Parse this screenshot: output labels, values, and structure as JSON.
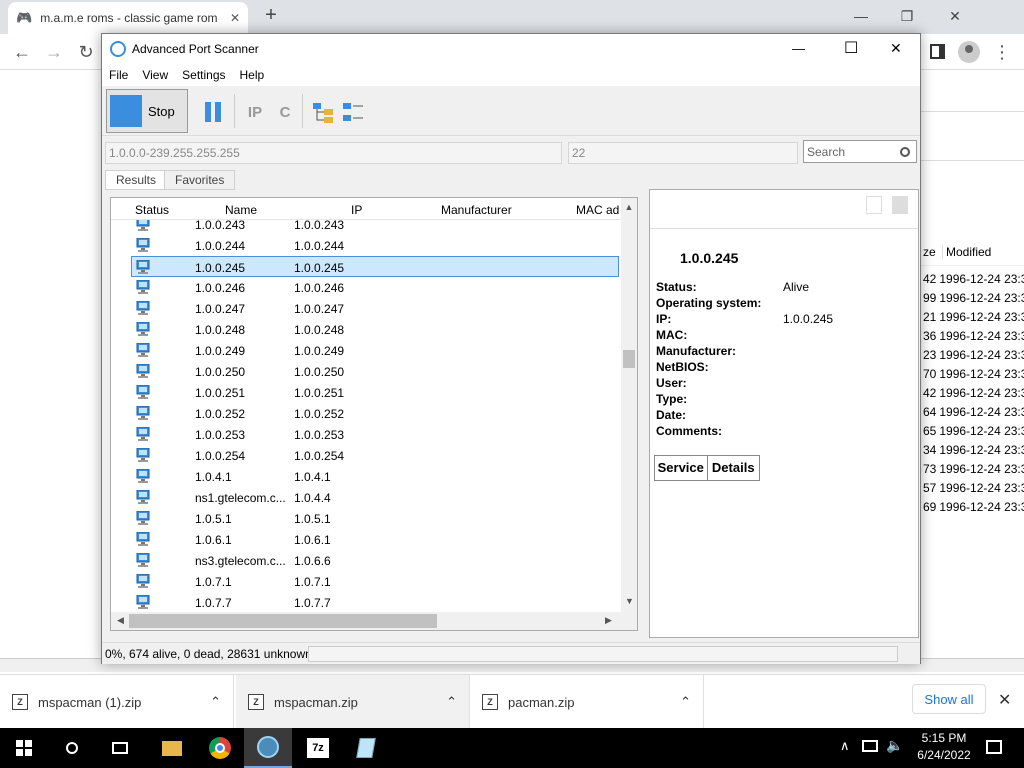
{
  "browser": {
    "tab_title": "m.a.m.e roms - classic game rom",
    "tab_close": "✕",
    "new_tab": "+",
    "minimize": "—",
    "maximize": "❐",
    "close": "✕",
    "back": "←",
    "forward": "→",
    "reload": "↻",
    "menu": "⋮"
  },
  "bg_explorer": {
    "col_size": "ze",
    "col_modified": "Modified",
    "rows": [
      {
        "size": "42",
        "date": "1996-12-24 23:3"
      },
      {
        "size": "99",
        "date": "1996-12-24 23:3"
      },
      {
        "size": "21",
        "date": "1996-12-24 23:3"
      },
      {
        "size": "36",
        "date": "1996-12-24 23:3"
      },
      {
        "size": "23",
        "date": "1996-12-24 23:3"
      },
      {
        "size": "70",
        "date": "1996-12-24 23:3"
      },
      {
        "size": "42",
        "date": "1996-12-24 23:3"
      },
      {
        "size": "64",
        "date": "1996-12-24 23:3"
      },
      {
        "size": "65",
        "date": "1996-12-24 23:3"
      },
      {
        "size": "34",
        "date": "1996-12-24 23:3"
      },
      {
        "size": "73",
        "date": "1996-12-24 23:3"
      },
      {
        "size": "57",
        "date": "1996-12-24 23:3"
      },
      {
        "size": "69",
        "date": "1996-12-24 23:3"
      }
    ]
  },
  "scanner": {
    "title": "Advanced Port Scanner",
    "win_min": "—",
    "win_max": "☐",
    "win_close": "✕",
    "menu": [
      "File",
      "View",
      "Settings",
      "Help"
    ],
    "stop_label": "Stop",
    "ip_range": "1.0.0.0-239.255.255.255",
    "ports": "22",
    "search_placeholder": "Search",
    "tabs": [
      "Results",
      "Favorites"
    ],
    "columns": {
      "status": "Status",
      "name": "Name",
      "ip": "IP",
      "manufacturer": "Manufacturer",
      "mac": "MAC ad"
    },
    "rows": [
      {
        "name": "1.0.0.243",
        "ip": "1.0.0.243"
      },
      {
        "name": "1.0.0.244",
        "ip": "1.0.0.244"
      },
      {
        "name": "1.0.0.245",
        "ip": "1.0.0.245"
      },
      {
        "name": "1.0.0.246",
        "ip": "1.0.0.246"
      },
      {
        "name": "1.0.0.247",
        "ip": "1.0.0.247"
      },
      {
        "name": "1.0.0.248",
        "ip": "1.0.0.248"
      },
      {
        "name": "1.0.0.249",
        "ip": "1.0.0.249"
      },
      {
        "name": "1.0.0.250",
        "ip": "1.0.0.250"
      },
      {
        "name": "1.0.0.251",
        "ip": "1.0.0.251"
      },
      {
        "name": "1.0.0.252",
        "ip": "1.0.0.252"
      },
      {
        "name": "1.0.0.253",
        "ip": "1.0.0.253"
      },
      {
        "name": "1.0.0.254",
        "ip": "1.0.0.254"
      },
      {
        "name": "1.0.4.1",
        "ip": "1.0.4.1"
      },
      {
        "name": "ns1.gtelecom.c...",
        "ip": "1.0.4.4"
      },
      {
        "name": "1.0.5.1",
        "ip": "1.0.5.1"
      },
      {
        "name": "1.0.6.1",
        "ip": "1.0.6.1"
      },
      {
        "name": "ns3.gtelecom.c...",
        "ip": "1.0.6.6"
      },
      {
        "name": "1.0.7.1",
        "ip": "1.0.7.1"
      },
      {
        "name": "1.0.7.7",
        "ip": "1.0.7.7"
      }
    ],
    "selected_index": 2,
    "details": {
      "host": "1.0.0.245",
      "fields": [
        {
          "label": "Status:",
          "value": "Alive"
        },
        {
          "label": "Operating system:",
          "value": ""
        },
        {
          "label": "IP:",
          "value": "1.0.0.245"
        },
        {
          "label": "MAC:",
          "value": ""
        },
        {
          "label": "Manufacturer:",
          "value": ""
        },
        {
          "label": "NetBIOS:",
          "value": ""
        },
        {
          "label": "User:",
          "value": ""
        },
        {
          "label": "Type:",
          "value": ""
        },
        {
          "label": "Date:",
          "value": ""
        },
        {
          "label": "Comments:",
          "value": ""
        }
      ],
      "service_tab": "Service",
      "details_tab": "Details"
    },
    "status_text": "0%, 674 alive, 0 dead, 28631 unknown"
  },
  "downloads": {
    "items": [
      "mspacman (1).zip",
      "mspacman.zip",
      "pacman.zip"
    ],
    "show_all": "Show all",
    "close": "✕"
  },
  "taskbar": {
    "time": "5:15 PM",
    "date": "6/24/2022"
  },
  "colors": {
    "accent": "#3b8ede",
    "selection": "#cce8ff",
    "link": "#1a73e8"
  }
}
